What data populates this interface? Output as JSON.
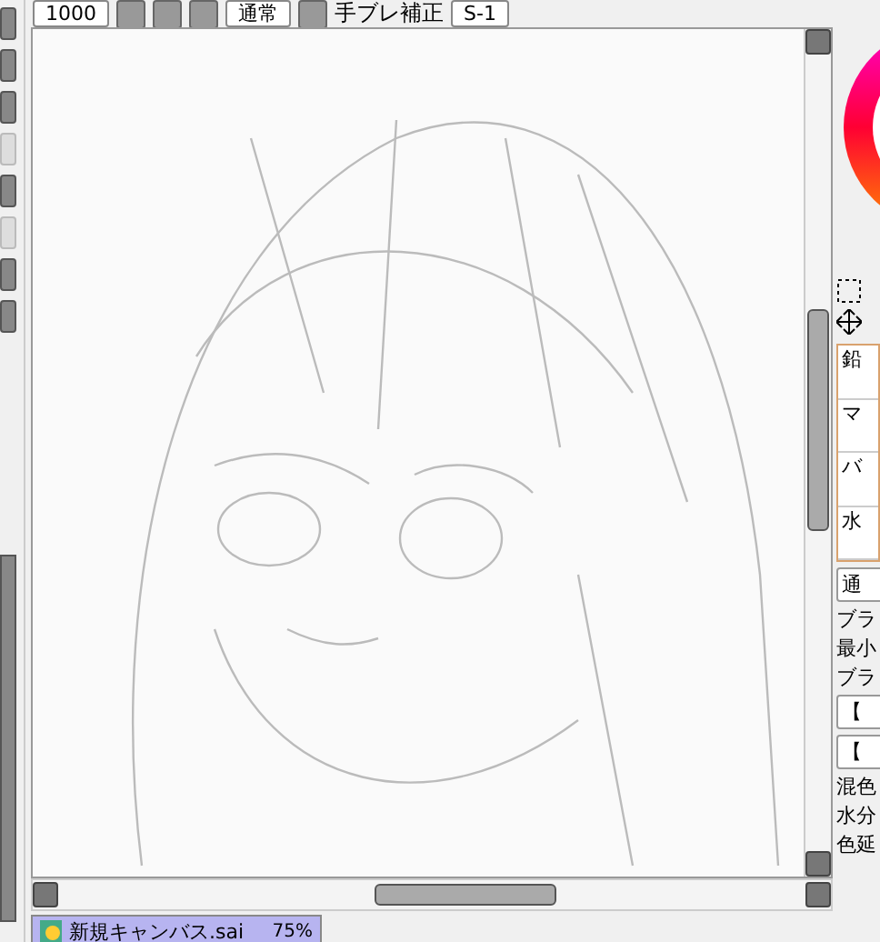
{
  "toolbar": {
    "size_value": "1000",
    "blend_mode": "通常",
    "stabilizer_label": "手ブレ補正",
    "stabilizer_value": "S-1"
  },
  "brush_list": [
    {
      "label": "鉛",
      "selected": false
    },
    {
      "label": "マ",
      "selected": false
    },
    {
      "label": "バ",
      "selected": false
    },
    {
      "label": "水",
      "selected": false
    }
  ],
  "brush_settings": {
    "mode": "通",
    "lines": [
      {
        "kind": "text",
        "label": "ブラ"
      },
      {
        "kind": "text",
        "label": "最小"
      },
      {
        "kind": "text",
        "label": "ブラ"
      },
      {
        "kind": "select",
        "label": "【"
      },
      {
        "kind": "select",
        "label": "【"
      },
      {
        "kind": "text",
        "label": "混色"
      },
      {
        "kind": "text",
        "label": "水分"
      },
      {
        "kind": "text",
        "label": "色延"
      }
    ]
  },
  "document_tabs": [
    {
      "name": "新規キャンバス.sai",
      "zoom": "75%",
      "selected": true
    }
  ]
}
